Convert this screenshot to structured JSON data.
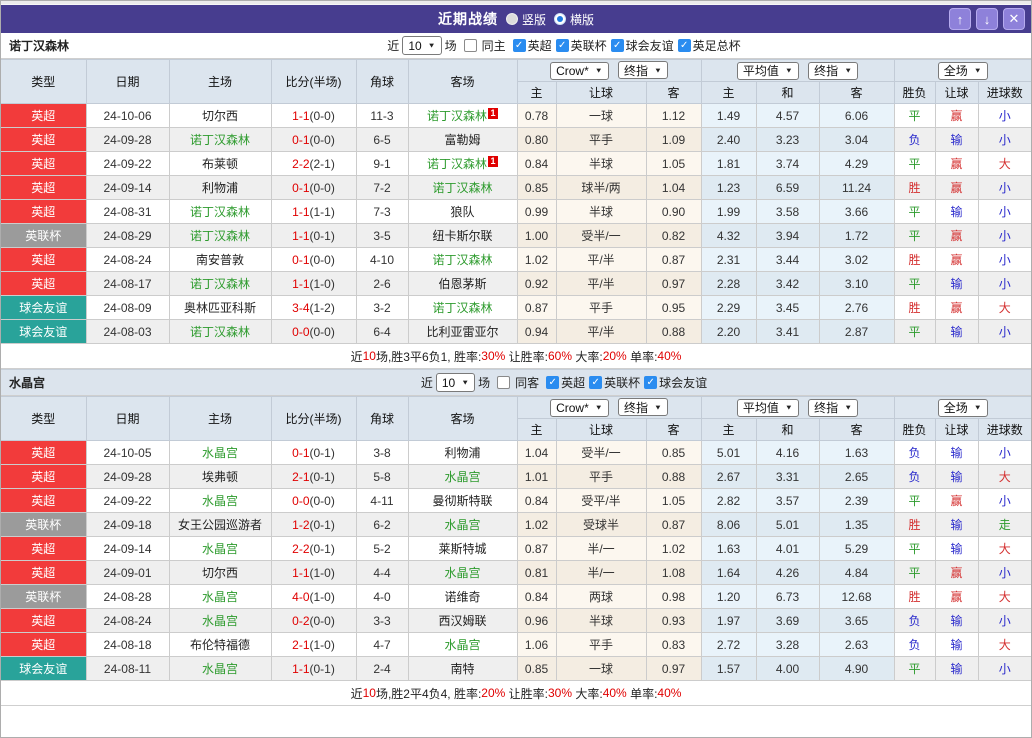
{
  "titlebar": {
    "title": "近期战绩",
    "radios": [
      {
        "label": "竖版",
        "checked": false
      },
      {
        "label": "横版",
        "checked": true
      }
    ],
    "up_icon": "↑",
    "down_icon": "↓",
    "close_icon": "✕"
  },
  "table_header": {
    "type": "类型",
    "date": "日期",
    "home": "主场",
    "score": "比分(半场)",
    "corners": "角球",
    "away": "客场",
    "odds_select": "Crow*",
    "odds_select2": "终指",
    "avg_select": "平均值",
    "avg_select2": "终指",
    "scope_select": "全场",
    "sub": {
      "h": "主",
      "handicap": "让球",
      "a": "客",
      "avg_h": "主",
      "avg_d": "和",
      "avg_a": "客",
      "wdl": "胜负",
      "handicap2": "让球",
      "goals": "进球数"
    }
  },
  "sections": [
    {
      "team": "诺丁汉森林",
      "filter": {
        "prefix": "近",
        "count": "10",
        "suffix": "场",
        "same": "同主",
        "leagues": [
          "英超",
          "英联杯",
          "球会友谊",
          "英足总杯"
        ]
      },
      "rows": [
        {
          "league": "英超",
          "league_color": "red",
          "date": "24-10-06",
          "home": "切尔西",
          "home_color": "plain",
          "home_redcard": "",
          "score": "1-1",
          "half": "(0-0)",
          "corners": "11-3",
          "away": "诺丁汉森林",
          "away_color": "green",
          "away_redcard": "1",
          "odds_home": "0.78",
          "odds_line": "一球",
          "odds_away": "1.12",
          "avg_home": "1.49",
          "avg_draw": "4.57",
          "avg_away": "6.06",
          "result": "平",
          "result_color": "green",
          "handicap_result": "赢",
          "handicap_color": "red",
          "goals_result": "小",
          "goals_color": "blue"
        },
        {
          "league": "英超",
          "league_color": "red",
          "date": "24-09-28",
          "home": "诺丁汉森林",
          "home_color": "green",
          "home_redcard": "",
          "score": "0-1",
          "half": "(0-0)",
          "corners": "6-5",
          "away": "富勒姆",
          "away_color": "plain",
          "away_redcard": "",
          "odds_home": "0.80",
          "odds_line": "平手",
          "odds_away": "1.09",
          "avg_home": "2.40",
          "avg_draw": "3.23",
          "avg_away": "3.04",
          "result": "负",
          "result_color": "blue",
          "handicap_result": "输",
          "handicap_color": "blue",
          "goals_result": "小",
          "goals_color": "blue"
        },
        {
          "league": "英超",
          "league_color": "red",
          "date": "24-09-22",
          "home": "布莱顿",
          "home_color": "plain",
          "home_redcard": "",
          "score": "2-2",
          "half": "(2-1)",
          "corners": "9-1",
          "away": "诺丁汉森林",
          "away_color": "green",
          "away_redcard": "1",
          "odds_home": "0.84",
          "odds_line": "半球",
          "odds_away": "1.05",
          "avg_home": "1.81",
          "avg_draw": "3.74",
          "avg_away": "4.29",
          "result": "平",
          "result_color": "green",
          "handicap_result": "赢",
          "handicap_color": "red",
          "goals_result": "大",
          "goals_color": "red"
        },
        {
          "league": "英超",
          "league_color": "red",
          "date": "24-09-14",
          "home": "利物浦",
          "home_color": "plain",
          "home_redcard": "",
          "score": "0-1",
          "half": "(0-0)",
          "corners": "7-2",
          "away": "诺丁汉森林",
          "away_color": "green",
          "away_redcard": "",
          "odds_home": "0.85",
          "odds_line": "球半/两",
          "odds_away": "1.04",
          "avg_home": "1.23",
          "avg_draw": "6.59",
          "avg_away": "11.24",
          "result": "胜",
          "result_color": "red",
          "handicap_result": "赢",
          "handicap_color": "red",
          "goals_result": "小",
          "goals_color": "blue"
        },
        {
          "league": "英超",
          "league_color": "red",
          "date": "24-08-31",
          "home": "诺丁汉森林",
          "home_color": "green",
          "home_redcard": "",
          "score": "1-1",
          "half": "(1-1)",
          "corners": "7-3",
          "away": "狼队",
          "away_color": "plain",
          "away_redcard": "",
          "odds_home": "0.99",
          "odds_line": "半球",
          "odds_away": "0.90",
          "avg_home": "1.99",
          "avg_draw": "3.58",
          "avg_away": "3.66",
          "result": "平",
          "result_color": "green",
          "handicap_result": "输",
          "handicap_color": "blue",
          "goals_result": "小",
          "goals_color": "blue"
        },
        {
          "league": "英联杯",
          "league_color": "gray",
          "date": "24-08-29",
          "home": "诺丁汉森林",
          "home_color": "green",
          "home_redcard": "",
          "score": "1-1",
          "half": "(0-1)",
          "corners": "3-5",
          "away": "纽卡斯尔联",
          "away_color": "plain",
          "away_redcard": "",
          "odds_home": "1.00",
          "odds_line": "受半/一",
          "odds_away": "0.82",
          "avg_home": "4.32",
          "avg_draw": "3.94",
          "avg_away": "1.72",
          "result": "平",
          "result_color": "green",
          "handicap_result": "赢",
          "handicap_color": "red",
          "goals_result": "小",
          "goals_color": "blue"
        },
        {
          "league": "英超",
          "league_color": "red",
          "date": "24-08-24",
          "home": "南安普敦",
          "home_color": "plain",
          "home_redcard": "",
          "score": "0-1",
          "half": "(0-0)",
          "corners": "4-10",
          "away": "诺丁汉森林",
          "away_color": "green",
          "away_redcard": "",
          "odds_home": "1.02",
          "odds_line": "平/半",
          "odds_away": "0.87",
          "avg_home": "2.31",
          "avg_draw": "3.44",
          "avg_away": "3.02",
          "result": "胜",
          "result_color": "red",
          "handicap_result": "赢",
          "handicap_color": "red",
          "goals_result": "小",
          "goals_color": "blue"
        },
        {
          "league": "英超",
          "league_color": "red",
          "date": "24-08-17",
          "home": "诺丁汉森林",
          "home_color": "green",
          "home_redcard": "",
          "score": "1-1",
          "half": "(1-0)",
          "corners": "2-6",
          "away": "伯恩茅斯",
          "away_color": "plain",
          "away_redcard": "",
          "odds_home": "0.92",
          "odds_line": "平/半",
          "odds_away": "0.97",
          "avg_home": "2.28",
          "avg_draw": "3.42",
          "avg_away": "3.10",
          "result": "平",
          "result_color": "green",
          "handicap_result": "输",
          "handicap_color": "blue",
          "goals_result": "小",
          "goals_color": "blue"
        },
        {
          "league": "球会友谊",
          "league_color": "teal",
          "date": "24-08-09",
          "home": "奥林匹亚科斯",
          "home_color": "plain",
          "home_redcard": "",
          "score": "3-4",
          "half": "(1-2)",
          "corners": "3-2",
          "away": "诺丁汉森林",
          "away_color": "green",
          "away_redcard": "",
          "odds_home": "0.87",
          "odds_line": "平手",
          "odds_away": "0.95",
          "avg_home": "2.29",
          "avg_draw": "3.45",
          "avg_away": "2.76",
          "result": "胜",
          "result_color": "red",
          "handicap_result": "赢",
          "handicap_color": "red",
          "goals_result": "大",
          "goals_color": "red"
        },
        {
          "league": "球会友谊",
          "league_color": "teal",
          "date": "24-08-03",
          "home": "诺丁汉森林",
          "home_color": "green",
          "home_redcard": "",
          "score": "0-0",
          "half": "(0-0)",
          "corners": "6-4",
          "away": "比利亚雷亚尔",
          "away_color": "plain",
          "away_redcard": "",
          "odds_home": "0.94",
          "odds_line": "平/半",
          "odds_away": "0.88",
          "avg_home": "2.20",
          "avg_draw": "3.41",
          "avg_away": "2.87",
          "result": "平",
          "result_color": "green",
          "handicap_result": "输",
          "handicap_color": "blue",
          "goals_result": "小",
          "goals_color": "blue"
        }
      ],
      "summary": [
        {
          "text": "近",
          "color": "k"
        },
        {
          "text": "10",
          "color": "r"
        },
        {
          "text": "场,胜3平6负1, 胜率:",
          "color": "k"
        },
        {
          "text": "30%",
          "color": "r"
        },
        {
          "text": " 让胜率:",
          "color": "k"
        },
        {
          "text": "60%",
          "color": "r"
        },
        {
          "text": " 大率:",
          "color": "k"
        },
        {
          "text": "20%",
          "color": "r"
        },
        {
          "text": " 单率:",
          "color": "k"
        },
        {
          "text": "40%",
          "color": "r"
        }
      ]
    },
    {
      "team": "水晶宫",
      "filter": {
        "prefix": "近",
        "count": "10",
        "suffix": "场",
        "same": "同客",
        "leagues": [
          "英超",
          "英联杯",
          "球会友谊"
        ]
      },
      "rows": [
        {
          "league": "英超",
          "league_color": "red",
          "date": "24-10-05",
          "home": "水晶宫",
          "home_color": "green",
          "home_redcard": "",
          "score": "0-1",
          "half": "(0-1)",
          "corners": "3-8",
          "away": "利物浦",
          "away_color": "plain",
          "away_redcard": "",
          "odds_home": "1.04",
          "odds_line": "受半/一",
          "odds_away": "0.85",
          "avg_home": "5.01",
          "avg_draw": "4.16",
          "avg_away": "1.63",
          "result": "负",
          "result_color": "blue",
          "handicap_result": "输",
          "handicap_color": "blue",
          "goals_result": "小",
          "goals_color": "blue"
        },
        {
          "league": "英超",
          "league_color": "red",
          "date": "24-09-28",
          "home": "埃弗顿",
          "home_color": "plain",
          "home_redcard": "",
          "score": "2-1",
          "half": "(0-1)",
          "corners": "5-8",
          "away": "水晶宫",
          "away_color": "green",
          "away_redcard": "",
          "odds_home": "1.01",
          "odds_line": "平手",
          "odds_away": "0.88",
          "avg_home": "2.67",
          "avg_draw": "3.31",
          "avg_away": "2.65",
          "result": "负",
          "result_color": "blue",
          "handicap_result": "输",
          "handicap_color": "blue",
          "goals_result": "大",
          "goals_color": "red"
        },
        {
          "league": "英超",
          "league_color": "red",
          "date": "24-09-22",
          "home": "水晶宫",
          "home_color": "green",
          "home_redcard": "",
          "score": "0-0",
          "half": "(0-0)",
          "corners": "4-11",
          "away": "曼彻斯特联",
          "away_color": "plain",
          "away_redcard": "",
          "odds_home": "0.84",
          "odds_line": "受平/半",
          "odds_away": "1.05",
          "avg_home": "2.82",
          "avg_draw": "3.57",
          "avg_away": "2.39",
          "result": "平",
          "result_color": "green",
          "handicap_result": "赢",
          "handicap_color": "red",
          "goals_result": "小",
          "goals_color": "blue"
        },
        {
          "league": "英联杯",
          "league_color": "gray",
          "date": "24-09-18",
          "home": "女王公园巡游者",
          "home_color": "plain",
          "home_redcard": "",
          "score": "1-2",
          "half": "(0-1)",
          "corners": "6-2",
          "away": "水晶宫",
          "away_color": "green",
          "away_redcard": "",
          "odds_home": "1.02",
          "odds_line": "受球半",
          "odds_away": "0.87",
          "avg_home": "8.06",
          "avg_draw": "5.01",
          "avg_away": "1.35",
          "result": "胜",
          "result_color": "red",
          "handicap_result": "输",
          "handicap_color": "blue",
          "goals_result": "走",
          "goals_color": "green"
        },
        {
          "league": "英超",
          "league_color": "red",
          "date": "24-09-14",
          "home": "水晶宫",
          "home_color": "green",
          "home_redcard": "",
          "score": "2-2",
          "half": "(0-1)",
          "corners": "5-2",
          "away": "莱斯特城",
          "away_color": "plain",
          "away_redcard": "",
          "odds_home": "0.87",
          "odds_line": "半/一",
          "odds_away": "1.02",
          "avg_home": "1.63",
          "avg_draw": "4.01",
          "avg_away": "5.29",
          "result": "平",
          "result_color": "green",
          "handicap_result": "输",
          "handicap_color": "blue",
          "goals_result": "大",
          "goals_color": "red"
        },
        {
          "league": "英超",
          "league_color": "red",
          "date": "24-09-01",
          "home": "切尔西",
          "home_color": "plain",
          "home_redcard": "",
          "score": "1-1",
          "half": "(1-0)",
          "corners": "4-4",
          "away": "水晶宫",
          "away_color": "green",
          "away_redcard": "",
          "odds_home": "0.81",
          "odds_line": "半/一",
          "odds_away": "1.08",
          "avg_home": "1.64",
          "avg_draw": "4.26",
          "avg_away": "4.84",
          "result": "平",
          "result_color": "green",
          "handicap_result": "赢",
          "handicap_color": "red",
          "goals_result": "小",
          "goals_color": "blue"
        },
        {
          "league": "英联杯",
          "league_color": "gray",
          "date": "24-08-28",
          "home": "水晶宫",
          "home_color": "green",
          "home_redcard": "",
          "score": "4-0",
          "half": "(1-0)",
          "corners": "4-0",
          "away": "诺维奇",
          "away_color": "plain",
          "away_redcard": "",
          "odds_home": "0.84",
          "odds_line": "两球",
          "odds_away": "0.98",
          "avg_home": "1.20",
          "avg_draw": "6.73",
          "avg_away": "12.68",
          "result": "胜",
          "result_color": "red",
          "handicap_result": "赢",
          "handicap_color": "red",
          "goals_result": "大",
          "goals_color": "red"
        },
        {
          "league": "英超",
          "league_color": "red",
          "date": "24-08-24",
          "home": "水晶宫",
          "home_color": "green",
          "home_redcard": "",
          "score": "0-2",
          "half": "(0-0)",
          "corners": "3-3",
          "away": "西汉姆联",
          "away_color": "plain",
          "away_redcard": "",
          "odds_home": "0.96",
          "odds_line": "半球",
          "odds_away": "0.93",
          "avg_home": "1.97",
          "avg_draw": "3.69",
          "avg_away": "3.65",
          "result": "负",
          "result_color": "blue",
          "handicap_result": "输",
          "handicap_color": "blue",
          "goals_result": "小",
          "goals_color": "blue"
        },
        {
          "league": "英超",
          "league_color": "red",
          "date": "24-08-18",
          "home": "布伦特福德",
          "home_color": "plain",
          "home_redcard": "",
          "score": "2-1",
          "half": "(1-0)",
          "corners": "4-7",
          "away": "水晶宫",
          "away_color": "green",
          "away_redcard": "",
          "odds_home": "1.06",
          "odds_line": "平手",
          "odds_away": "0.83",
          "avg_home": "2.72",
          "avg_draw": "3.28",
          "avg_away": "2.63",
          "result": "负",
          "result_color": "blue",
          "handicap_result": "输",
          "handicap_color": "blue",
          "goals_result": "大",
          "goals_color": "red"
        },
        {
          "league": "球会友谊",
          "league_color": "teal",
          "date": "24-08-11",
          "home": "水晶宫",
          "home_color": "green",
          "home_redcard": "",
          "score": "1-1",
          "half": "(0-1)",
          "corners": "2-4",
          "away": "南特",
          "away_color": "plain",
          "away_redcard": "",
          "odds_home": "0.85",
          "odds_line": "一球",
          "odds_away": "0.97",
          "avg_home": "1.57",
          "avg_draw": "4.00",
          "avg_away": "4.90",
          "result": "平",
          "result_color": "green",
          "handicap_result": "输",
          "handicap_color": "blue",
          "goals_result": "小",
          "goals_color": "blue"
        }
      ],
      "summary": [
        {
          "text": "近",
          "color": "k"
        },
        {
          "text": "10",
          "color": "r"
        },
        {
          "text": "场,胜2平4负4, 胜率:",
          "color": "k"
        },
        {
          "text": "20%",
          "color": "r"
        },
        {
          "text": " 让胜率:",
          "color": "k"
        },
        {
          "text": "30%",
          "color": "r"
        },
        {
          "text": " 大率:",
          "color": "k"
        },
        {
          "text": "40%",
          "color": "r"
        },
        {
          "text": " 单率:",
          "color": "k"
        },
        {
          "text": "40%",
          "color": "r"
        }
      ]
    }
  ]
}
